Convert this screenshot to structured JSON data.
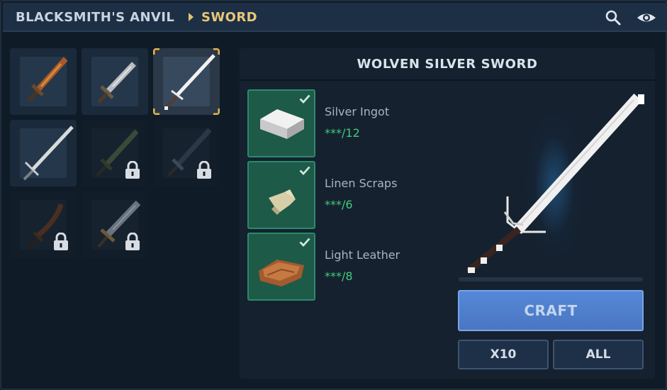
{
  "header": {
    "breadcrumb_root": "BLACKSMITH'S ANVIL",
    "breadcrumb_current": "SWORD",
    "search_icon": "search-icon",
    "view_icon": "eye-icon"
  },
  "recipes": [
    {
      "name": "rusty-sword",
      "locked": false,
      "selected": false
    },
    {
      "name": "iron-sword",
      "locked": false,
      "selected": false
    },
    {
      "name": "wolven-silver-sword",
      "locked": false,
      "selected": true
    },
    {
      "name": "silver-longsword",
      "locked": false,
      "selected": false
    },
    {
      "name": "green-sword",
      "locked": true,
      "selected": false
    },
    {
      "name": "dark-sword",
      "locked": true,
      "selected": false
    },
    {
      "name": "curved-blade",
      "locked": true,
      "selected": false
    },
    {
      "name": "ornate-broadsword",
      "locked": true,
      "selected": false
    }
  ],
  "detail": {
    "title": "WOLVEN SILVER SWORD",
    "materials": [
      {
        "name": "Silver Ingot",
        "count": "***/12",
        "icon": "silver-ingot-icon"
      },
      {
        "name": "Linen Scraps",
        "count": "***/6",
        "icon": "linen-scraps-icon"
      },
      {
        "name": "Light Leather",
        "count": "***/8",
        "icon": "light-leather-icon"
      }
    ],
    "progress": 0,
    "craft_label": "CRAFT",
    "x10_label": "X10",
    "all_label": "ALL"
  },
  "colors": {
    "accent_gold": "#e8c678",
    "available_green": "#3fcc7c",
    "craft_blue": "#4f80cc"
  }
}
